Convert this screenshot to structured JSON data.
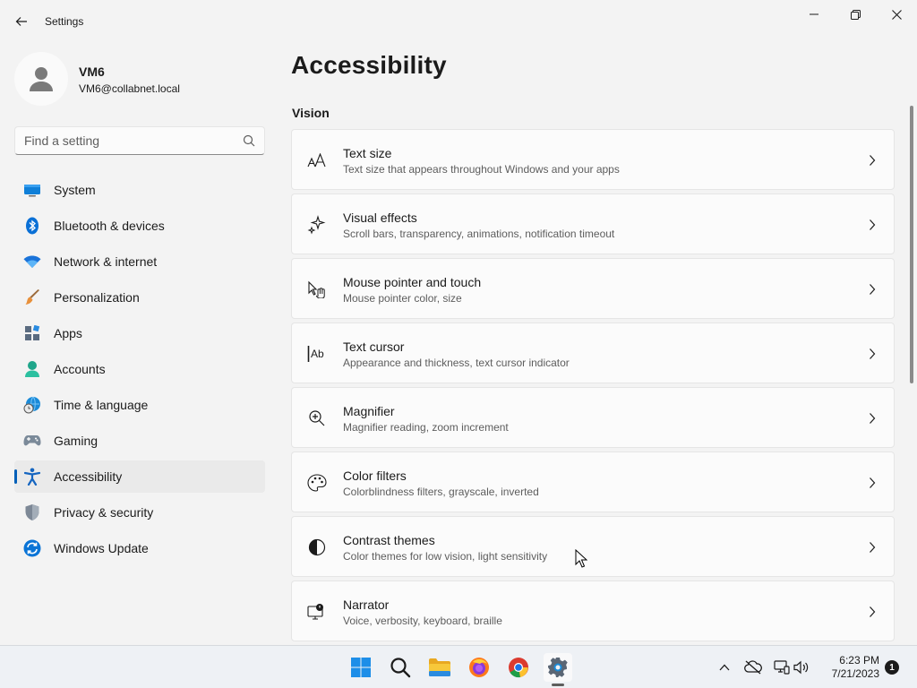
{
  "window": {
    "title": "Settings",
    "back_icon": "back-arrow-icon",
    "controls": [
      "minimize-icon",
      "maximize-icon",
      "close-icon"
    ]
  },
  "profile": {
    "name": "VM6",
    "email": "VM6@collabnet.local"
  },
  "search": {
    "placeholder": "Find a setting",
    "value": ""
  },
  "sidebar": {
    "items": [
      {
        "label": "System",
        "icon": "system-monitor-icon"
      },
      {
        "label": "Bluetooth & devices",
        "icon": "bluetooth-icon"
      },
      {
        "label": "Network & internet",
        "icon": "wifi-icon"
      },
      {
        "label": "Personalization",
        "icon": "paintbrush-icon"
      },
      {
        "label": "Apps",
        "icon": "apps-icon"
      },
      {
        "label": "Accounts",
        "icon": "account-icon"
      },
      {
        "label": "Time & language",
        "icon": "globe-clock-icon"
      },
      {
        "label": "Gaming",
        "icon": "gamepad-icon"
      },
      {
        "label": "Accessibility",
        "icon": "accessibility-icon",
        "selected": true
      },
      {
        "label": "Privacy & security",
        "icon": "shield-icon"
      },
      {
        "label": "Windows Update",
        "icon": "update-icon"
      }
    ]
  },
  "main": {
    "title": "Accessibility",
    "section": "Vision",
    "cards": [
      {
        "title": "Text size",
        "description": "Text size that appears throughout Windows and your apps",
        "icon": "text-size-icon"
      },
      {
        "title": "Visual effects",
        "description": "Scroll bars, transparency, animations, notification timeout",
        "icon": "sparkle-icon"
      },
      {
        "title": "Mouse pointer and touch",
        "description": "Mouse pointer color, size",
        "icon": "pointer-touch-icon"
      },
      {
        "title": "Text cursor",
        "description": "Appearance and thickness, text cursor indicator",
        "icon": "text-cursor-icon"
      },
      {
        "title": "Magnifier",
        "description": "Magnifier reading, zoom increment",
        "icon": "magnifier-icon"
      },
      {
        "title": "Color filters",
        "description": "Colorblindness filters, grayscale, inverted",
        "icon": "palette-icon"
      },
      {
        "title": "Contrast themes",
        "description": "Color themes for low vision, light sensitivity",
        "icon": "contrast-icon"
      },
      {
        "title": "Narrator",
        "description": "Voice, verbosity, keyboard, braille",
        "icon": "narrator-icon"
      }
    ]
  },
  "taskbar": {
    "apps": [
      "windows-start-icon",
      "search-icon",
      "file-explorer-icon",
      "firefox-icon",
      "chrome-icon",
      "settings-icon"
    ],
    "active_app": "settings-icon",
    "tray": [
      "chevron-up-icon",
      "cloud-offline-icon",
      "network-icon",
      "volume-icon"
    ],
    "time": "6:23 PM",
    "date": "7/21/2023",
    "notification_count": "1"
  },
  "colors": {
    "accent": "#005fb8",
    "background": "#f3f3f3",
    "card": "#fbfbfb"
  }
}
